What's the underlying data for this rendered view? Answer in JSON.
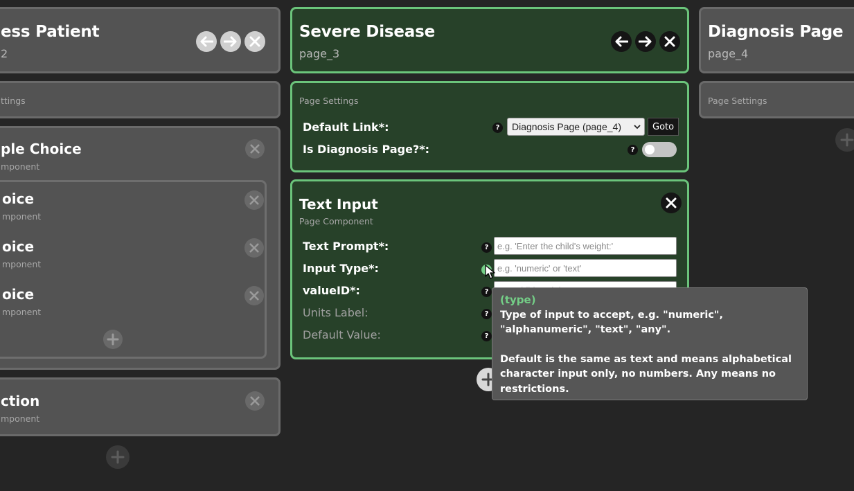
{
  "pages": {
    "left": {
      "title": "ess Patient",
      "id": "2",
      "settings_label": "ttings"
    },
    "center": {
      "title": "Severe Disease",
      "id": "page_3",
      "settings_label": "Page Settings"
    },
    "right": {
      "title": "Diagnosis Page",
      "id": "page_4",
      "settings_label": "Page Settings"
    }
  },
  "left_components": {
    "multiple_choice": {
      "title": "ple Choice",
      "sub": "mponent"
    },
    "choices": [
      {
        "title": "oice",
        "sub": "mponent"
      },
      {
        "title": "oice",
        "sub": "mponent"
      },
      {
        "title": "oice",
        "sub": "mponent"
      }
    ],
    "bottom": {
      "title": "ction",
      "sub": "mponent"
    }
  },
  "page_settings": {
    "default_link_label": "Default Link*:",
    "default_link_value": "Diagnosis Page (page_4)",
    "goto_label": "Goto",
    "is_diagnosis_label": "Is Diagnosis Page?*:",
    "is_diagnosis_value": false
  },
  "text_input": {
    "title": "Text Input",
    "sub": "Page Component",
    "fields": {
      "text_prompt": {
        "label": "Text Prompt*:",
        "placeholder": "e.g. 'Enter the child's weight:'"
      },
      "input_type": {
        "label": "Input Type*:",
        "placeholder": "e.g. 'numeric' or 'text'"
      },
      "value_id": {
        "label": "valueID*:",
        "placeholder": "e.g. 'child_weight'"
      },
      "units_label": {
        "label": "Units Label:"
      },
      "default_value": {
        "label": "Default Value:"
      }
    }
  },
  "help_glyph": "?",
  "tooltip": {
    "title": "(type)",
    "line1": "Type of input to accept, e.g. \"numeric\", \"alphanumeric\", \"text\", \"any\".",
    "line2": "Default is the same as text and means alphabetical character input only, no numbers. Any means no restrictions."
  },
  "icons": [
    "arrow-left-icon",
    "arrow-right-icon",
    "close-icon",
    "plus-icon",
    "chevron-down-icon",
    "mouse-cursor-icon"
  ],
  "colors": {
    "background": "#252525",
    "active_card": "#274129",
    "active_border": "#6bc47b",
    "inactive_card": "#535353",
    "tooltip_accent": "#74cf87"
  }
}
